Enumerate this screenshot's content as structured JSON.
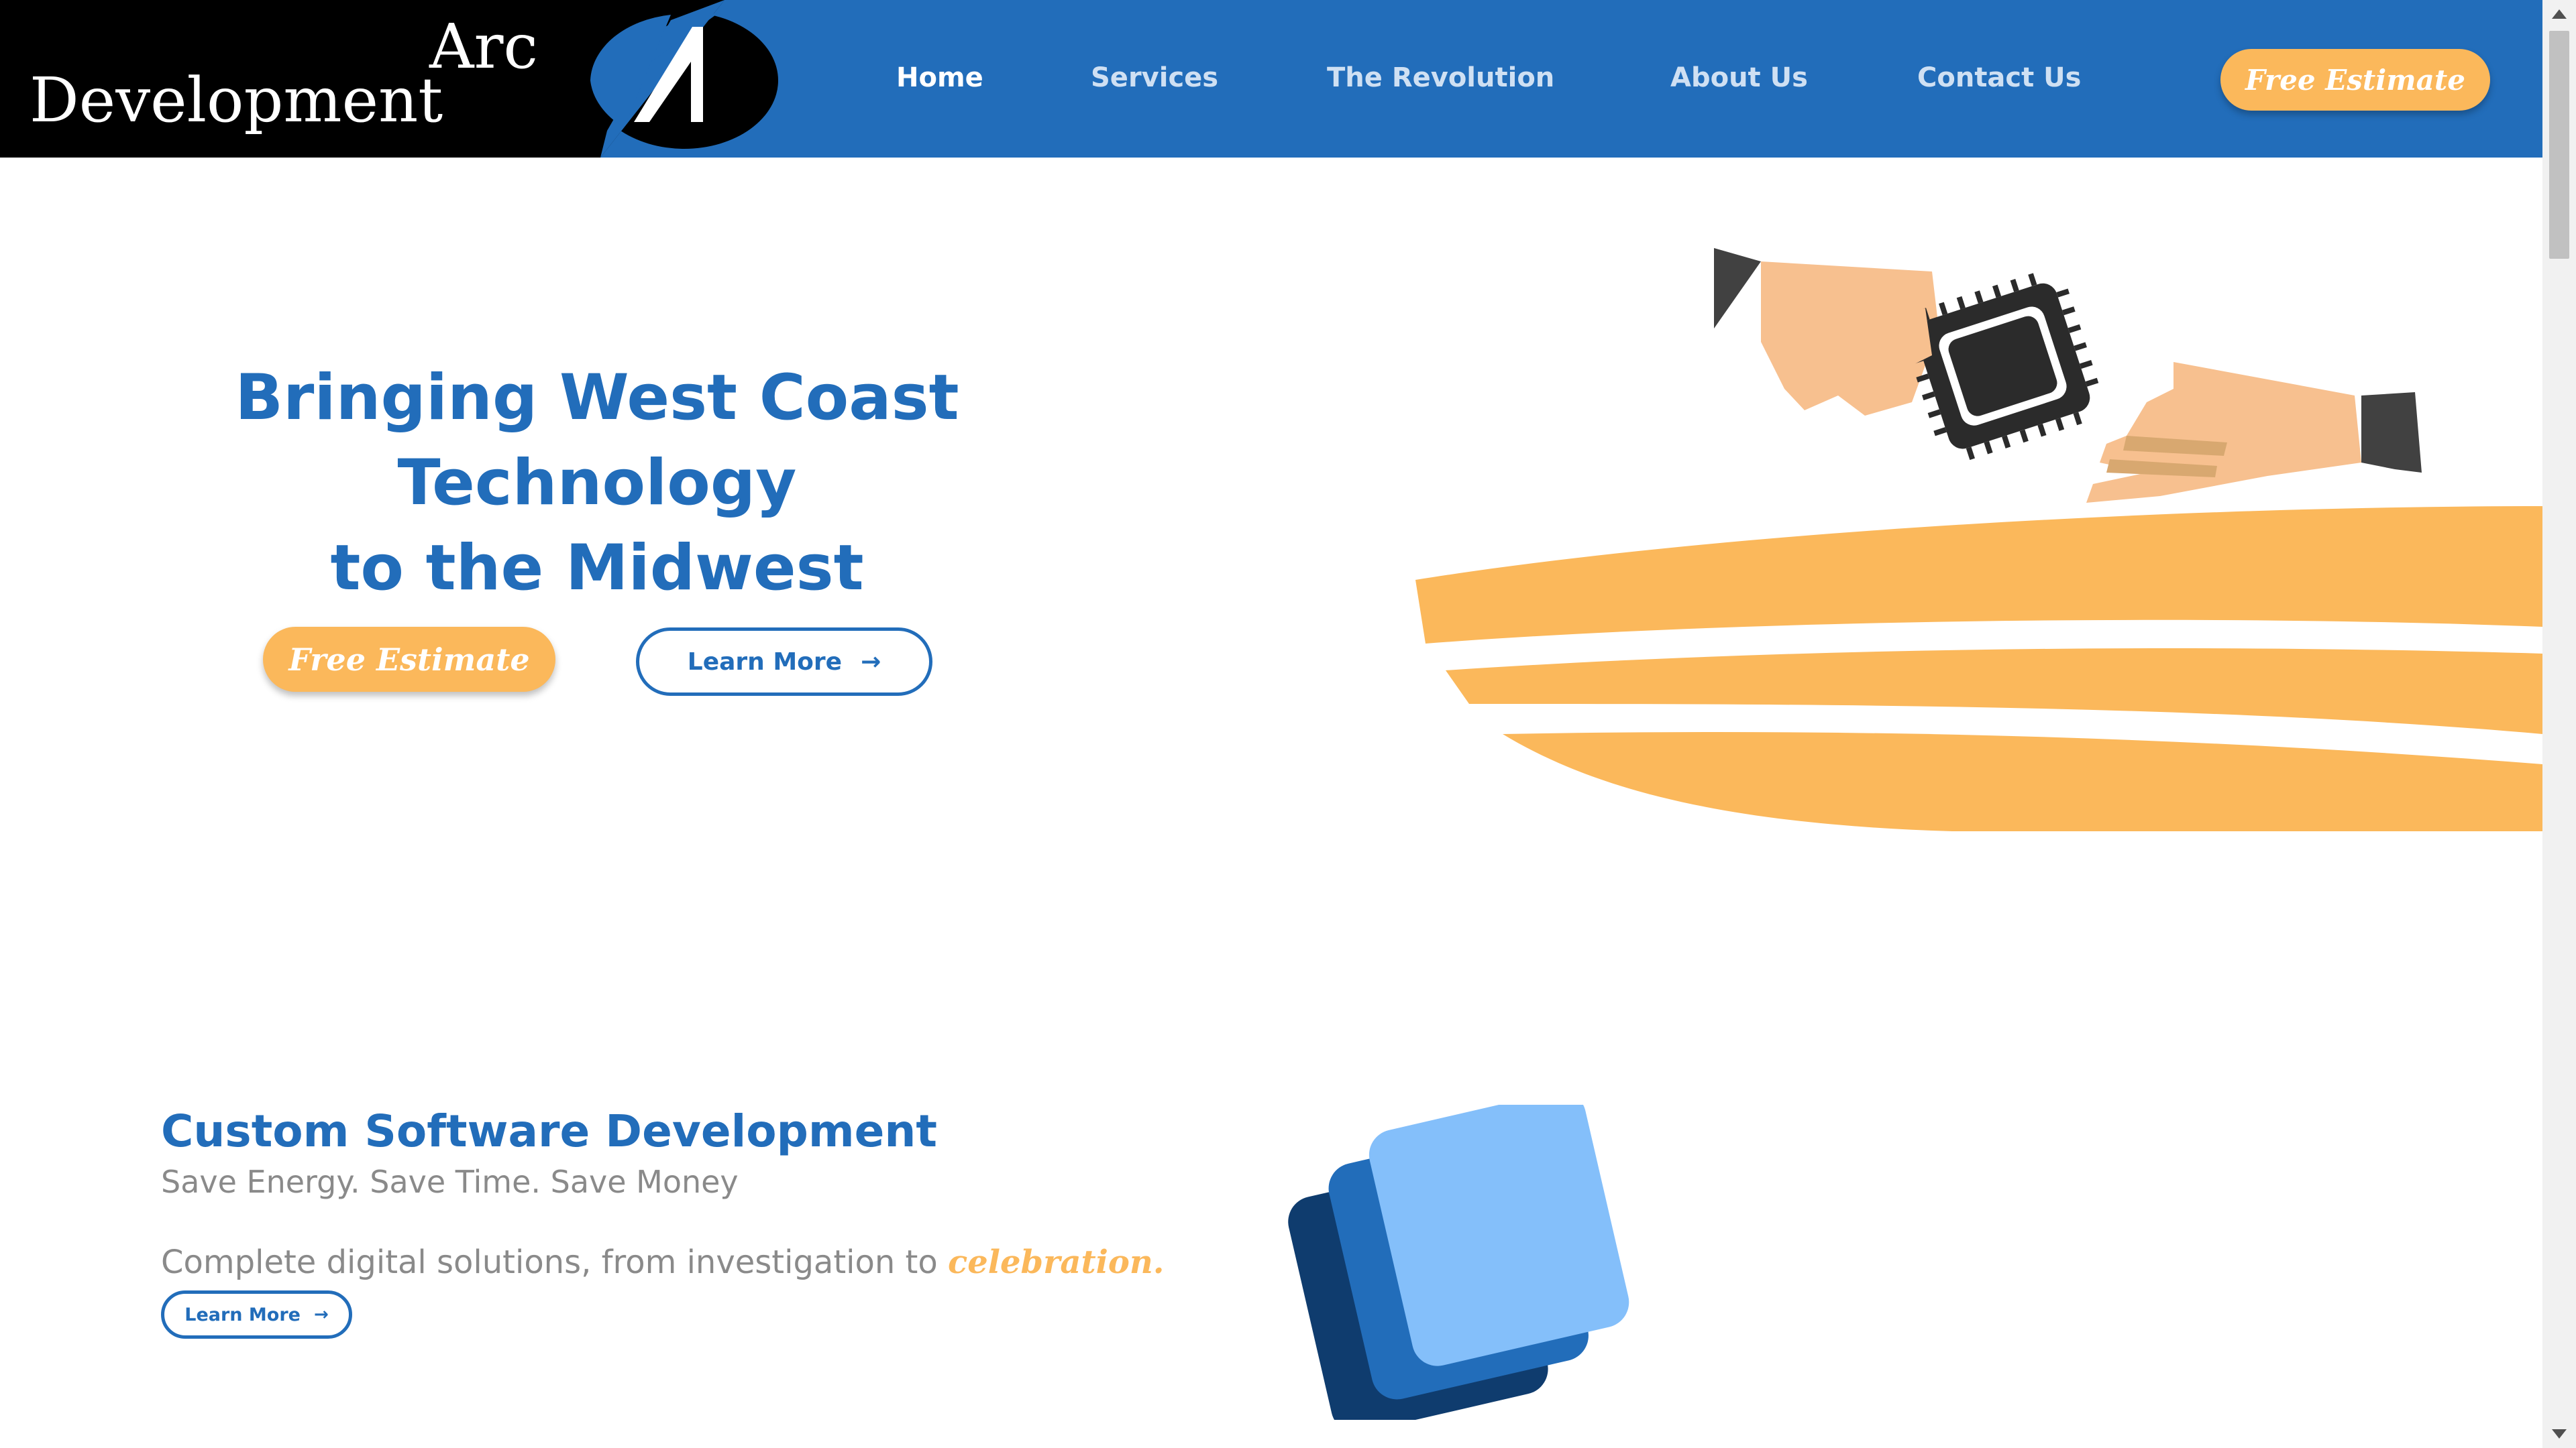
{
  "header": {
    "logo": {
      "line1": "Arc",
      "line2": "Development"
    },
    "nav": [
      {
        "label": "Home"
      },
      {
        "label": "Services"
      },
      {
        "label": "The Revolution"
      },
      {
        "label": "About Us"
      },
      {
        "label": "Contact Us"
      }
    ],
    "estimate_label": "Free Estimate"
  },
  "hero": {
    "title_line1": "Bringing West Coast",
    "title_line2": "Technology",
    "title_line3": "to the Midwest",
    "estimate_label": "Free Estimate",
    "learn_more_label": "Learn More",
    "arrow_icon": "arrow-right-icon"
  },
  "section": {
    "title": "Custom Software Development",
    "subtitle": "Save Energy. Save Time. Save Money",
    "description": "Complete digital solutions, from investigation to ",
    "accent_word": "celebration.",
    "learn_more_label": "Learn More"
  },
  "colors": {
    "primary": "#226DBA",
    "accent": "#FBB85B",
    "white": "#FFFFFF",
    "text_gray": "#8A8A8A"
  }
}
